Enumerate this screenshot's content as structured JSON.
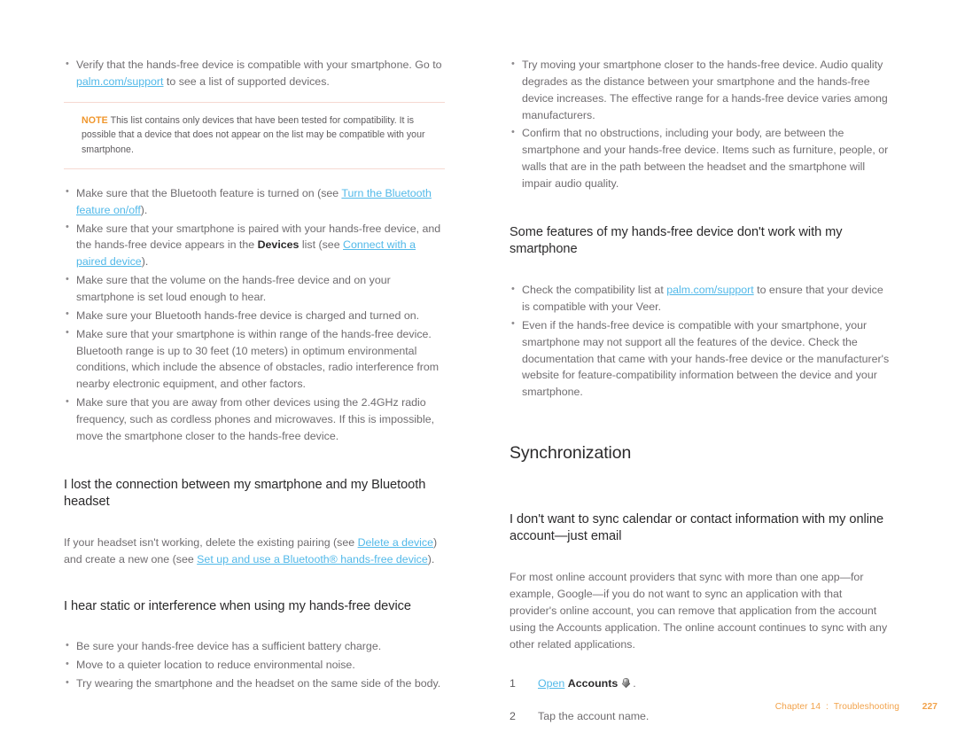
{
  "document": {
    "title": "Palm Veer User Guide",
    "footer": {
      "chapter": "Chapter 14",
      "separator": ":",
      "section": "Troubleshooting",
      "page_number": "227",
      "color": "#f2a24a"
    },
    "colors": {
      "link": "#52b9e9",
      "body_text": "#706d70",
      "heading_text": "#2b2a2b",
      "note_label": "#f0962c",
      "note_rule": "#f6d9d2",
      "footer": "#f2a24a"
    }
  },
  "left_column": {
    "bullets_top": [
      {
        "pre": "Verify that the hands-free device is compatible with your smartphone. Go to ",
        "link": "palm.com/support",
        "post": " to see a list of supported devices."
      }
    ],
    "note": {
      "label": "NOTE",
      "text": "This list contains only devices that have been tested for compatibility. It is possible that a device that does not appear on the list may be compatible with your smartphone."
    },
    "bullets_main": [
      {
        "pre": "Make sure that the Bluetooth feature is turned on (see ",
        "link": "Turn the Bluetooth feature on/off",
        "post": ")."
      },
      {
        "pre": "Make sure that your smartphone is paired with your hands-free device, and the hands-free device appears in the ",
        "bold": "Devices",
        "mid": " list (see ",
        "link": "Connect with a paired device",
        "post": ")."
      },
      {
        "pre": "Make sure that the volume on the hands-free device and on your smartphone is set loud enough to hear."
      },
      {
        "pre": "Make sure your Bluetooth hands-free device is charged and turned on."
      },
      {
        "pre": "Make sure that your smartphone is within range of the hands-free device. Bluetooth range is up to 30 feet (10 meters) in optimum environmental conditions, which include the absence of obstacles, radio interference from nearby electronic equipment, and other factors."
      },
      {
        "pre": "Make sure that you are away from other devices using the 2.4GHz radio frequency, such as cordless phones and microwaves. If this is impossible, move the smartphone closer to the hands-free device."
      }
    ],
    "heading_lost_connection": "I lost the connection between my smartphone and my Bluetooth headset",
    "lost_connection_para": {
      "pre": "If your headset isn't working, delete the existing pairing (see ",
      "link1": "Delete a device",
      "mid": ") and create a new one (see ",
      "link2": "Set up and use a Bluetooth® hands-free device",
      "post": ")."
    },
    "heading_static": "I hear static or interference when using my hands-free device",
    "bullets_static": [
      {
        "pre": "Be sure your hands-free device has a sufficient battery charge."
      },
      {
        "pre": "Move to a quieter location to reduce environmental noise."
      },
      {
        "pre": "Try wearing the smartphone and the headset on the same side of the body."
      }
    ]
  },
  "right_column": {
    "bullets_top": [
      {
        "pre": "Try moving your smartphone closer to the hands-free device. Audio quality degrades as the distance between your smartphone and the hands-free device increases. The effective range for a hands-free device varies among manufacturers."
      },
      {
        "pre": "Confirm that no obstructions, including your body, are between the smartphone and your hands-free device. Items such as furniture, people, or walls that are in the path between the headset and the smartphone will impair audio quality."
      }
    ],
    "heading_some_features": "Some features of my hands-free device don't work with my smartphone",
    "bullets_features": [
      {
        "pre": "Check the compatibility list at ",
        "link": "palm.com/support",
        "post": " to ensure that your device is compatible with your Veer."
      },
      {
        "pre": "Even if the hands-free device is compatible with your smartphone, your smartphone may not support all the features of the device. Check the documentation that came with your hands-free device or the manufacturer's website for feature-compatibility information between the device and your smartphone."
      }
    ],
    "heading_synchronization": "Synchronization",
    "heading_dont_sync": "I don't want to sync calendar or contact information with my online account—just email",
    "sync_para": "For most online account providers that sync with more than one app—for example, Google—if you do not want to sync an application with that provider's online account, you can remove that application from the account using the Accounts application. The online account continues to sync with any other related applications.",
    "steps": [
      {
        "number": "1",
        "link": "Open",
        "bold": "Accounts",
        "icon": "accounts-app-icon",
        "post": "."
      },
      {
        "number": "2",
        "text": "Tap the account name."
      }
    ]
  }
}
